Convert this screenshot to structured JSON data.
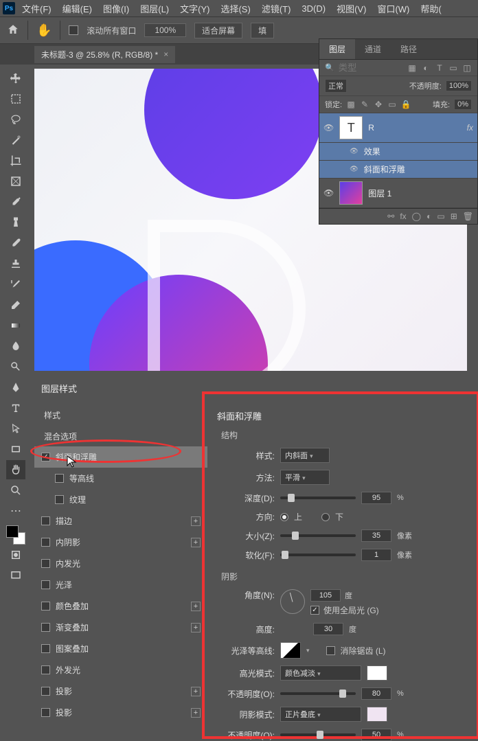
{
  "menu": {
    "items": [
      "文件(F)",
      "编辑(E)",
      "图像(I)",
      "图层(L)",
      "文字(Y)",
      "选择(S)",
      "滤镜(T)",
      "3D(D)",
      "视图(V)",
      "窗口(W)",
      "帮助("
    ]
  },
  "options": {
    "scroll_all": "滚动所有窗口",
    "zoom": "100%",
    "fit": "适合屏幕",
    "fill": "填"
  },
  "doc": {
    "title": "未标题-3 @ 25.8% (R, RGB/8) *"
  },
  "layers_panel": {
    "tabs": [
      "图层",
      "通道",
      "路径"
    ],
    "search_placeholder": "类型",
    "blend_mode": "正常",
    "opacity_label": "不透明度:",
    "opacity_value": "100%",
    "lock_label": "锁定:",
    "fill_label": "填充:",
    "fill_value": "0%",
    "layers": [
      {
        "name": "R",
        "thumb": "T",
        "fx": "fx"
      },
      {
        "name": "效果",
        "sub": true
      },
      {
        "name": "斜面和浮雕",
        "sub": true
      },
      {
        "name": "图层 1",
        "thumb": "grad"
      }
    ]
  },
  "dialog": {
    "title": "图层样式",
    "left": {
      "styles_hdr": "样式",
      "blend_hdr": "混合选项",
      "rows": [
        {
          "label": "斜面和浮雕",
          "checked": true,
          "selected": true
        },
        {
          "label": "等高线",
          "checked": false,
          "indent": true
        },
        {
          "label": "纹理",
          "checked": false,
          "indent": true
        },
        {
          "label": "描边",
          "checked": false,
          "plus": true
        },
        {
          "label": "内阴影",
          "checked": false,
          "plus": true
        },
        {
          "label": "内发光",
          "checked": false
        },
        {
          "label": "光泽",
          "checked": false
        },
        {
          "label": "颜色叠加",
          "checked": false,
          "plus": true
        },
        {
          "label": "渐变叠加",
          "checked": false,
          "plus": true
        },
        {
          "label": "图案叠加",
          "checked": false
        },
        {
          "label": "外发光",
          "checked": false
        },
        {
          "label": "投影",
          "checked": false,
          "plus": true
        },
        {
          "label": "投影",
          "checked": false,
          "plus": true
        }
      ]
    },
    "right": {
      "title": "斜面和浮雕",
      "structure": "结构",
      "style_label": "样式:",
      "style_value": "内斜面",
      "method_label": "方法:",
      "method_value": "平滑",
      "depth_label": "深度(D):",
      "depth_value": "95",
      "depth_unit": "%",
      "dir_label": "方向:",
      "dir_up": "上",
      "dir_down": "下",
      "size_label": "大小(Z):",
      "size_value": "35",
      "size_unit": "像素",
      "soften_label": "软化(F):",
      "soften_value": "1",
      "soften_unit": "像素",
      "shadow": "阴影",
      "angle_label": "角度(N):",
      "angle_value": "105",
      "angle_unit": "度",
      "global_label": "使用全局光 (G)",
      "alt_label": "高度:",
      "alt_value": "30",
      "alt_unit": "度",
      "gloss_label": "光泽等高线:",
      "antialias_label": "消除锯齿 (L)",
      "hl_mode_label": "高光模式:",
      "hl_mode_value": "颜色减淡",
      "hl_color": "#ffffff",
      "hl_op_label": "不透明度(O):",
      "hl_op_value": "80",
      "hl_op_unit": "%",
      "sh_mode_label": "阴影模式:",
      "sh_mode_value": "正片叠底",
      "sh_color": "#f0e4f2",
      "sh_op_label": "不透明度(O):",
      "sh_op_value": "50",
      "sh_op_unit": "%"
    }
  }
}
